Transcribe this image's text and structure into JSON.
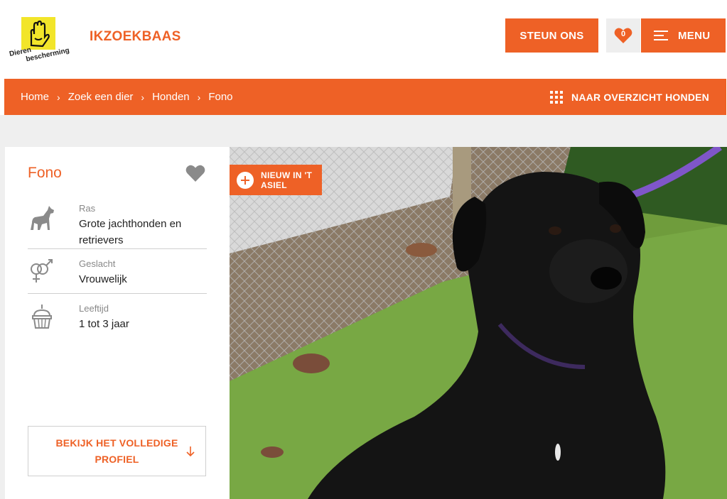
{
  "brand": {
    "logo_line1": "Dieren",
    "logo_line2": "bescherming",
    "name": "IKZOEKBAAS"
  },
  "header": {
    "steun_label": "STEUN ONS",
    "favorites_count": "0",
    "menu_label": "MENU"
  },
  "breadcrumb": {
    "items": [
      "Home",
      "Zoek een dier",
      "Honden",
      "Fono"
    ],
    "overview_label": "NAAR OVERZICHT HONDEN"
  },
  "pet": {
    "name": "Fono",
    "badge": "NIEUW IN 'T ASIEL",
    "details": [
      {
        "label": "Ras",
        "value": "Grote jachthonden en retrievers",
        "icon": "dog-icon"
      },
      {
        "label": "Geslacht",
        "value": "Vrouwelijk",
        "icon": "gender-icon"
      },
      {
        "label": "Leeftijd",
        "value": "1 tot 3 jaar",
        "icon": "cupcake-icon"
      }
    ],
    "profile_button": "BEKIJK HET VOLLEDIGE PROFIEL"
  },
  "colors": {
    "accent": "#ee6126",
    "logo_yellow": "#f2e52a",
    "background_grey": "#efefef"
  }
}
